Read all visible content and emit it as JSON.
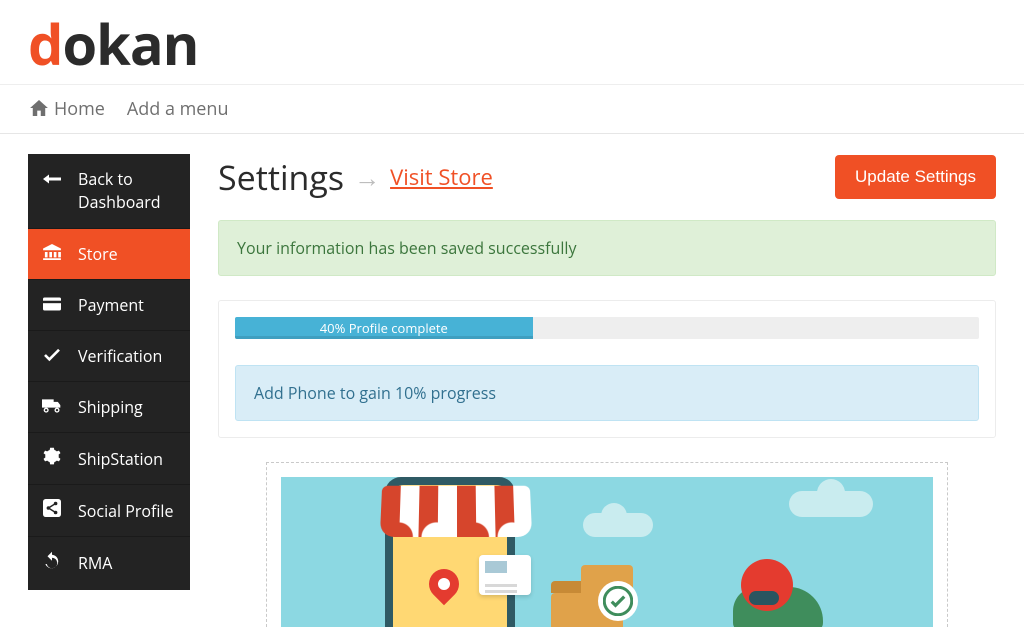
{
  "brand": {
    "first": "d",
    "rest": "okan"
  },
  "topnav": {
    "home": "Home",
    "add_menu": "Add a menu"
  },
  "sidebar": {
    "back_line1": "Back to",
    "back_line2": "Dashboard",
    "store": "Store",
    "payment": "Payment",
    "verification": "Verification",
    "shipping": "Shipping",
    "shipstation": "ShipStation",
    "social": "Social Profile",
    "rma": "RMA"
  },
  "header": {
    "title": "Settings",
    "visit_store": "Visit Store",
    "update_btn": "Update Settings"
  },
  "alert": {
    "success": "Your information has been saved successfully"
  },
  "progress": {
    "percent": 40,
    "label": "40% Profile complete",
    "hint": "Add Phone to gain 10% progress"
  }
}
